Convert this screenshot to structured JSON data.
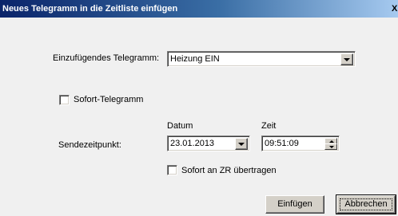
{
  "window": {
    "title": "Neues Telegramm in die Zeitliste einfügen",
    "close_glyph": "X",
    "close_icon": "close-icon"
  },
  "telegram": {
    "label": "Einzufügendes Telegramm:",
    "value": "Heizung EIN"
  },
  "sofort_telegramm": {
    "label": "Sofort-Telegramm",
    "checked": false
  },
  "sendezeitpunkt": {
    "label": "Sendezeitpunkt:",
    "datum_header": "Datum",
    "zeit_header": "Zeit",
    "datum_value": "23.01.2013",
    "zeit_value": "09:51:09"
  },
  "sofort_zr": {
    "label": "Sofort an ZR übertragen",
    "checked": false
  },
  "buttons": {
    "insert_label": "Einfügen",
    "cancel_label": "Abbrechen"
  },
  "icons": {
    "dropdown": "chevron-down-icon",
    "spin_up": "spin-up-icon",
    "spin_down": "spin-down-icon"
  }
}
